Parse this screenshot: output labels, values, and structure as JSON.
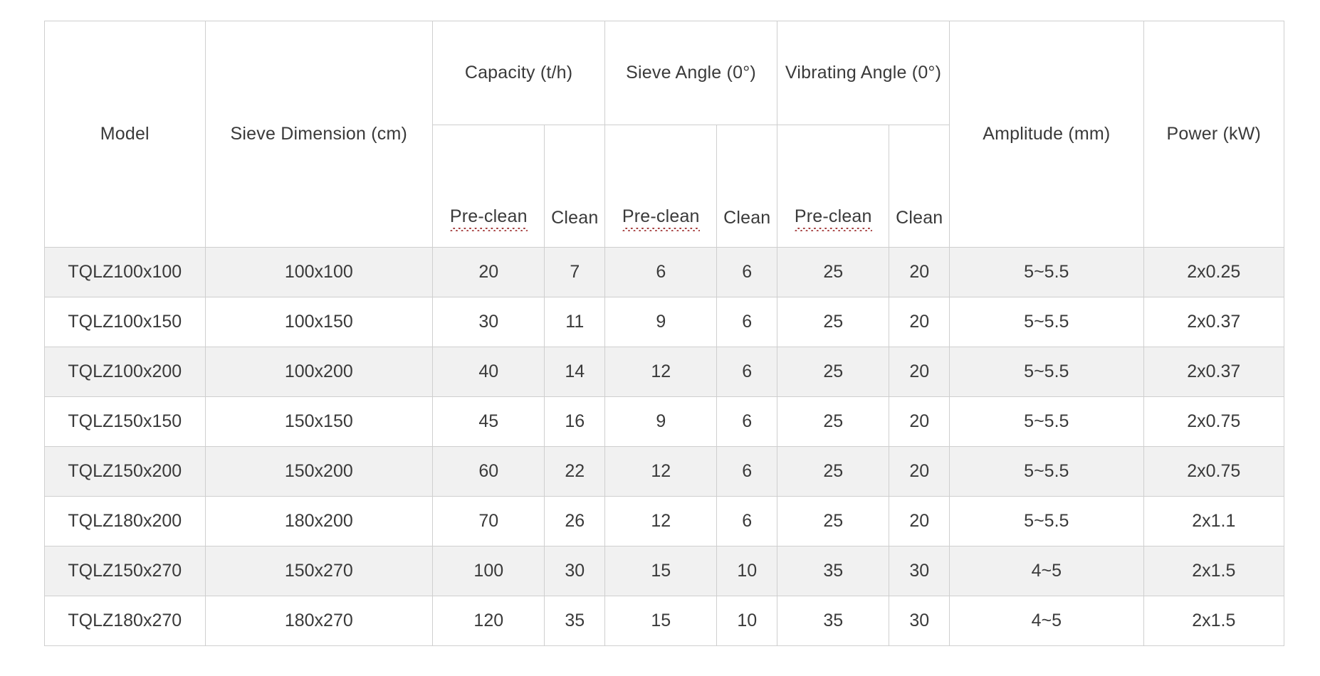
{
  "table": {
    "header": {
      "model": "Model",
      "sieve_dimension": "Sieve Dimension (cm)",
      "capacity": "Capacity (t/h)",
      "sieve_angle": "Sieve Angle (0°)",
      "vibrating_angle": "Vibrating Angle (0°)",
      "amplitude": "Amplitude (mm)",
      "power": "Power (kW)",
      "sub": {
        "capacity_pre": "Pre-clean",
        "capacity_clean": "Clean",
        "sieve_pre": "Pre-clean",
        "sieve_clean": "Clean",
        "vibrating_pre": "Pre-clean",
        "vibrating_clean": "Clean"
      }
    },
    "rows": [
      {
        "model": "TQLZ100x100",
        "sieve_dimension": "100x100",
        "capacity_pre": "20",
        "capacity_clean": "7",
        "sieve_angle_pre": "6",
        "sieve_angle_clean": "6",
        "vibrating_angle_pre": "25",
        "vibrating_angle_clean": "20",
        "amplitude": "5~5.5",
        "power": "2x0.25"
      },
      {
        "model": "TQLZ100x150",
        "sieve_dimension": "100x150",
        "capacity_pre": "30",
        "capacity_clean": "11",
        "sieve_angle_pre": "9",
        "sieve_angle_clean": "6",
        "vibrating_angle_pre": "25",
        "vibrating_angle_clean": "20",
        "amplitude": "5~5.5",
        "power": "2x0.37"
      },
      {
        "model": "TQLZ100x200",
        "sieve_dimension": "100x200",
        "capacity_pre": "40",
        "capacity_clean": "14",
        "sieve_angle_pre": "12",
        "sieve_angle_clean": "6",
        "vibrating_angle_pre": "25",
        "vibrating_angle_clean": "20",
        "amplitude": "5~5.5",
        "power": "2x0.37"
      },
      {
        "model": "TQLZ150x150",
        "sieve_dimension": "150x150",
        "capacity_pre": "45",
        "capacity_clean": "16",
        "sieve_angle_pre": "9",
        "sieve_angle_clean": "6",
        "vibrating_angle_pre": "25",
        "vibrating_angle_clean": "20",
        "amplitude": "5~5.5",
        "power": "2x0.75"
      },
      {
        "model": "TQLZ150x200",
        "sieve_dimension": "150x200",
        "capacity_pre": "60",
        "capacity_clean": "22",
        "sieve_angle_pre": "12",
        "sieve_angle_clean": "6",
        "vibrating_angle_pre": "25",
        "vibrating_angle_clean": "20",
        "amplitude": "5~5.5",
        "power": "2x0.75"
      },
      {
        "model": "TQLZ180x200",
        "sieve_dimension": "180x200",
        "capacity_pre": "70",
        "capacity_clean": "26",
        "sieve_angle_pre": "12",
        "sieve_angle_clean": "6",
        "vibrating_angle_pre": "25",
        "vibrating_angle_clean": "20",
        "amplitude": "5~5.5",
        "power": "2x1.1"
      },
      {
        "model": "TQLZ150x270",
        "sieve_dimension": "150x270",
        "capacity_pre": "100",
        "capacity_clean": "30",
        "sieve_angle_pre": "15",
        "sieve_angle_clean": "10",
        "vibrating_angle_pre": "35",
        "vibrating_angle_clean": "30",
        "amplitude": "4~5",
        "power": "2x1.5"
      },
      {
        "model": "TQLZ180x270",
        "sieve_dimension": "180x270",
        "capacity_pre": "120",
        "capacity_clean": "35",
        "sieve_angle_pre": "15",
        "sieve_angle_clean": "10",
        "vibrating_angle_pre": "35",
        "vibrating_angle_clean": "30",
        "amplitude": "4~5",
        "power": "2x1.5"
      }
    ]
  },
  "style": {
    "border_color": "#cfcfcf",
    "alt_row_background": "#f1f1f1",
    "text_color": "#3a3a3a",
    "spellcheck_underline_color": "#a33a3a"
  }
}
